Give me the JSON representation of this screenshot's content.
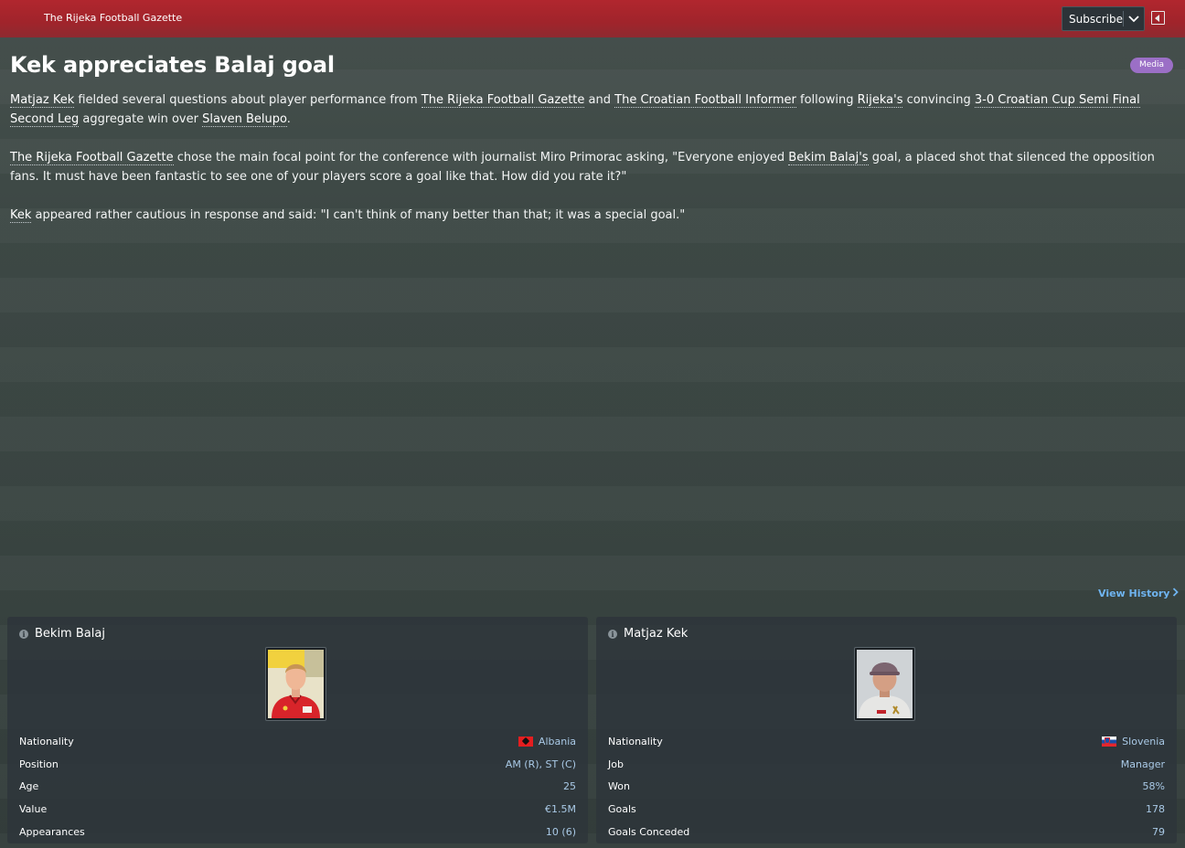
{
  "topbar": {
    "paper_name": "The Rijeka Football Gazette",
    "subscribe_label": "Subscribe"
  },
  "article": {
    "headline": "Kek appreciates Balaj goal",
    "badge": "Media",
    "p1": {
      "manager": "Matjaz Kek",
      "t1": " fielded several questions about player performance from ",
      "paper1": "The Rijeka Football Gazette",
      "t2": " and ",
      "paper2": "The Croatian Football Informer",
      "t3": " following ",
      "club": "Rijeka's",
      "t4": " convincing ",
      "match": "3-0 Croatian Cup Semi Final Second Leg",
      "t5": " aggregate win over ",
      "opponent": "Slaven Belupo",
      "t6": "."
    },
    "p2": {
      "paper": "The Rijeka Football Gazette",
      "t1": " chose the main focal point for the conference with journalist Miro Primorac asking, \"Everyone enjoyed ",
      "player": "Bekim Balaj's",
      "t2": " goal, a placed shot that silenced the opposition fans. It must have been fantastic to see one of your players score a goal like that. How did you rate it?\""
    },
    "p3": {
      "manager": "Kek",
      "t1": " appeared rather cautious in response and said: \"I can't think of many better than that; it was a special goal.\""
    }
  },
  "view_history_label": "View History",
  "cards": [
    {
      "name": "Bekim Balaj",
      "rows": [
        {
          "label": "Nationality",
          "value": "Albania"
        },
        {
          "label": "Position",
          "value": "AM (R), ST (C)"
        },
        {
          "label": "Age",
          "value": "25"
        },
        {
          "label": "Value",
          "value": "€1.5M"
        },
        {
          "label": "Appearances",
          "value": "10 (6)"
        }
      ]
    },
    {
      "name": "Matjaz Kek",
      "rows": [
        {
          "label": "Nationality",
          "value": "Slovenia"
        },
        {
          "label": "Job",
          "value": "Manager"
        },
        {
          "label": "Won",
          "value": "58%"
        },
        {
          "label": "Goals",
          "value": "178"
        },
        {
          "label": "Goals Conceded",
          "value": "79"
        }
      ]
    }
  ],
  "icons": {
    "subscribe_chevron": "chevron-down-icon",
    "panel_toggle": "sidebar-collapse-icon",
    "info": "info-icon",
    "view_history_chevron": "chevron-right-icon",
    "flag_albania": "albania-flag-icon",
    "flag_slovenia": "slovenia-flag-icon"
  },
  "colors": {
    "header_red": "#a0242b",
    "badge_purple": "#9b6fc6",
    "link_blue": "#6fb4f0",
    "value_blue": "#a9c9e6"
  }
}
